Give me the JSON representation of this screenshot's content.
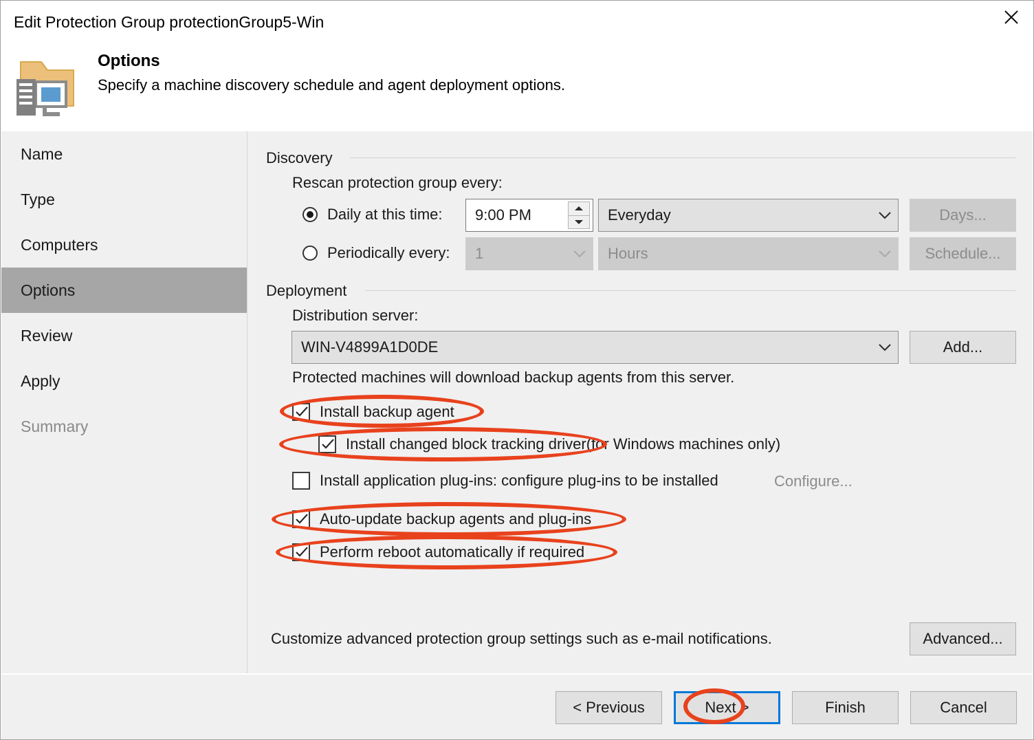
{
  "window": {
    "title": "Edit Protection Group protectionGroup5-Win",
    "close_icon": "close-icon"
  },
  "header": {
    "icon": "protection-group-folder-icon",
    "title": "Options",
    "subtitle": "Specify a machine discovery schedule and agent deployment options."
  },
  "sidebar": {
    "items": [
      {
        "label": "Name",
        "state": "normal"
      },
      {
        "label": "Type",
        "state": "normal"
      },
      {
        "label": "Computers",
        "state": "normal"
      },
      {
        "label": "Options",
        "state": "active"
      },
      {
        "label": "Review",
        "state": "normal"
      },
      {
        "label": "Apply",
        "state": "normal"
      },
      {
        "label": "Summary",
        "state": "disabled"
      }
    ]
  },
  "discovery": {
    "group_label": "Discovery",
    "rescan_label": "Rescan protection group every:",
    "daily": {
      "label": "Daily at this time:",
      "selected": true,
      "time_value": "9:00 PM",
      "frequency_value": "Everyday",
      "days_button": "Days...",
      "days_enabled": false
    },
    "periodic": {
      "label": "Periodically every:",
      "selected": false,
      "interval_value": "1",
      "unit_value": "Hours",
      "schedule_button": "Schedule...",
      "enabled": false
    }
  },
  "deployment": {
    "group_label": "Deployment",
    "distribution_server_label": "Distribution server:",
    "distribution_server_value": "WIN-V4899A1D0DE",
    "add_button": "Add...",
    "note": "Protected machines will download backup agents from this server.",
    "checkboxes": [
      {
        "label": "Install backup agent",
        "checked": true,
        "extra": "",
        "indent": 0
      },
      {
        "label": "Install changed block tracking driver",
        "checked": true,
        "extra": " (for Windows machines only)",
        "indent": 1
      },
      {
        "label": "Install application plug-ins: configure plug-ins to be installed",
        "checked": false,
        "extra": "",
        "indent": 0
      }
    ],
    "configure_link": "Configure...",
    "checkboxes2": [
      {
        "label": "Auto-update backup agents and plug-ins",
        "checked": true
      },
      {
        "label": "Perform reboot automatically if required",
        "checked": true
      }
    ],
    "advanced_note": "Customize advanced protection group settings such as e-mail notifications.",
    "advanced_button": "Advanced..."
  },
  "footer": {
    "previous": "< Previous",
    "next": "Next >",
    "finish": "Finish",
    "cancel": "Cancel"
  },
  "colors": {
    "annotation": "#e8421d",
    "focus": "#0078d7",
    "active_sidebar": "#a6a6a6",
    "panel": "#f0f0f0"
  }
}
